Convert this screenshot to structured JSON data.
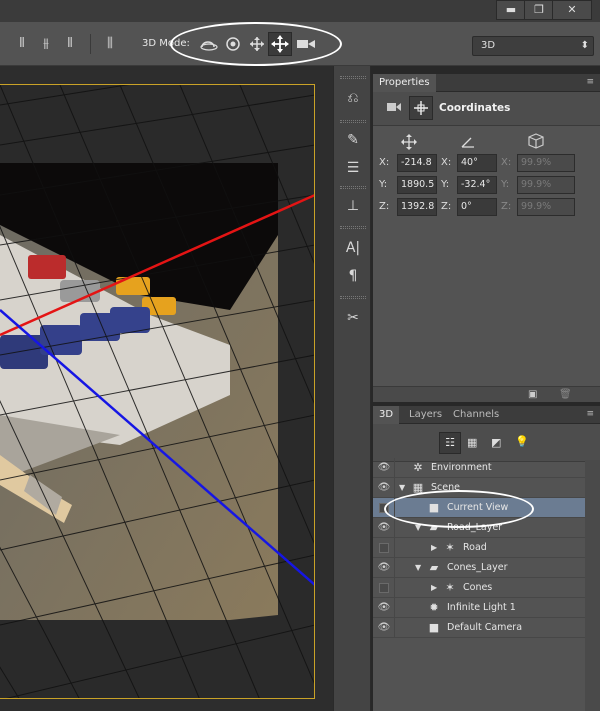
{
  "window": {
    "minimize": "▬",
    "restore": "❐",
    "close": "✕"
  },
  "options_bar": {
    "mode_label": "3D Mode:",
    "mode_select": "3D",
    "mode_select_arrow": "⬍",
    "tools": [
      "rotate-3d-icon",
      "roll-3d-icon",
      "drag-3d-icon",
      "slide-3d-icon",
      "scale-3d-camera-icon"
    ]
  },
  "properties": {
    "tab": "Properties",
    "section": "Coordinates",
    "rows": [
      {
        "axis": "X:",
        "pos": "-214.8",
        "rot_axis": "X:",
        "rot": "40°",
        "scl_axis": "X:",
        "scl": "99.9%"
      },
      {
        "axis": "Y:",
        "pos": "1890.5",
        "rot_axis": "Y:",
        "rot": "-32.4°",
        "scl_axis": "Y:",
        "scl": "99.9%"
      },
      {
        "axis": "Z:",
        "pos": "1392.8",
        "rot_axis": "Z:",
        "rot": "0°",
        "scl_axis": "Z:",
        "scl": "99.9%"
      }
    ]
  },
  "panel3d": {
    "tabs": [
      "3D",
      "Layers",
      "Channels"
    ],
    "items": [
      {
        "label": "Environment",
        "eye": true,
        "indent": 0,
        "icon": "✲",
        "tri": ""
      },
      {
        "label": "Scene",
        "eye": true,
        "indent": 0,
        "icon": "▦",
        "tri": "▼"
      },
      {
        "label": "Current View",
        "eye": false,
        "indent": 1,
        "icon": "■",
        "tri": "",
        "selected": true
      },
      {
        "label": "Road_Layer",
        "eye": true,
        "indent": 1,
        "icon": "▰",
        "tri": "▼"
      },
      {
        "label": "Road",
        "eye": false,
        "indent": 2,
        "icon": "✶",
        "tri": "▶"
      },
      {
        "label": "Cones_Layer",
        "eye": true,
        "indent": 1,
        "icon": "▰",
        "tri": "▼"
      },
      {
        "label": "Cones",
        "eye": false,
        "indent": 2,
        "icon": "✶",
        "tri": "▶"
      },
      {
        "label": "Infinite Light 1",
        "eye": true,
        "indent": 1,
        "icon": "✹",
        "tri": ""
      },
      {
        "label": "Default Camera",
        "eye": true,
        "indent": 1,
        "icon": "■",
        "tri": ""
      }
    ]
  }
}
